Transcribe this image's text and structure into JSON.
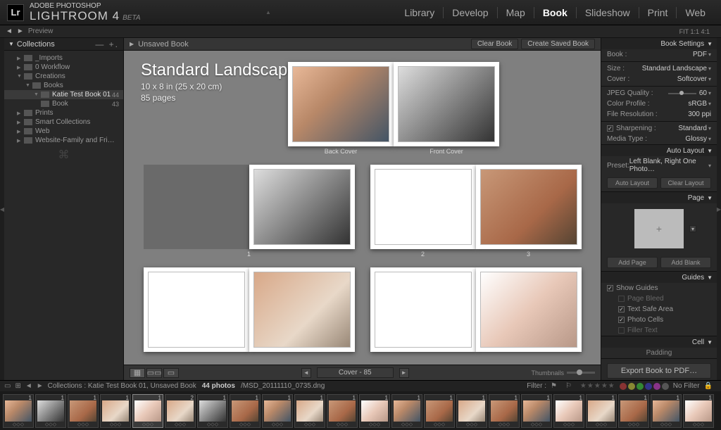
{
  "app": {
    "brand_top": "ADOBE PHOTOSHOP",
    "brand": "LIGHTROOM 4",
    "beta": "BETA"
  },
  "modules": {
    "items": [
      "Library",
      "Develop",
      "Map",
      "Book",
      "Slideshow",
      "Print",
      "Web"
    ],
    "active": "Book"
  },
  "secbar": {
    "preview": "Preview",
    "fit": "FIT   1:1   4:1"
  },
  "collections": {
    "title": "Collections",
    "items": [
      {
        "label": "_Imports",
        "indent": 1,
        "tri": "▶"
      },
      {
        "label": "0 Workflow",
        "indent": 1,
        "tri": "▶"
      },
      {
        "label": "Creations",
        "indent": 1,
        "tri": "▼"
      },
      {
        "label": "Books",
        "indent": 2,
        "tri": "▼"
      },
      {
        "label": "Katie Test Book 01",
        "indent": 3,
        "tri": "▼",
        "count": "44",
        "sel": true
      },
      {
        "label": "Book",
        "indent": 3,
        "tri": "",
        "count": "43",
        "book": true
      },
      {
        "label": "Prints",
        "indent": 1,
        "tri": "▶"
      },
      {
        "label": "Smart Collections",
        "indent": 1,
        "tri": "▶"
      },
      {
        "label": "Web",
        "indent": 1,
        "tri": "▶"
      },
      {
        "label": "Website-Family and Fri…",
        "indent": 1,
        "tri": "▶"
      }
    ]
  },
  "midtop": {
    "title": "Unsaved Book",
    "clear": "Clear Book",
    "save": "Create Saved Book"
  },
  "book": {
    "title": "Standard Landscape",
    "dims": "10 x 8 in (25 x 20 cm)",
    "pages": "85 pages",
    "back_cover": "Back Cover",
    "front_cover": "Front Cover"
  },
  "pager": {
    "label": "Cover - 85",
    "thumbs": "Thumbnails"
  },
  "right": {
    "book_settings": "Book Settings",
    "book": "Book :",
    "book_v": "PDF",
    "size": "Size :",
    "size_v": "Standard Landscape",
    "cover": "Cover :",
    "cover_v": "Softcover",
    "jpeg": "JPEG Quality :",
    "jpeg_v": "60",
    "profile": "Color Profile :",
    "profile_v": "sRGB",
    "res": "File Resolution :",
    "res_v": "300 ppi",
    "sharp": "Sharpening :",
    "sharp_v": "Standard",
    "media": "Media Type :",
    "media_v": "Glossy",
    "auto_layout": "Auto Layout",
    "preset": "Preset:",
    "preset_v": "Left Blank, Right One Photo…",
    "auto_btn": "Auto Layout",
    "clear_btn": "Clear Layout",
    "page": "Page",
    "add_page": "Add Page",
    "add_blank": "Add Blank",
    "guides": "Guides",
    "show_guides": "Show Guides",
    "page_bleed": "Page Bleed",
    "text_safe": "Text Safe Area",
    "photo_cells": "Photo Cells",
    "filler": "Filler Text",
    "cell": "Cell",
    "padding": "Padding",
    "export": "Export Book to PDF…"
  },
  "filmstrip": {
    "path": "Collections : Katie Test Book 01, Unsaved Book",
    "count": "44 photos",
    "file": "/MSD_20111110_0735.dng",
    "filter": "Filter :",
    "nofilter": "No Filter"
  },
  "thumbs": [
    {
      "n": "1",
      "c": "color1"
    },
    {
      "n": "1",
      "c": "bw"
    },
    {
      "n": "1",
      "c": "color2"
    },
    {
      "n": "1",
      "c": "color3"
    },
    {
      "n": "1",
      "c": "color4",
      "sel": true
    },
    {
      "n": "2",
      "c": "color3"
    },
    {
      "n": "1",
      "c": "bw"
    },
    {
      "n": "1",
      "c": "color2"
    },
    {
      "n": "1",
      "c": "color1"
    },
    {
      "n": "1",
      "c": "color3"
    },
    {
      "n": "1",
      "c": "color2"
    },
    {
      "n": "1",
      "c": "color4"
    },
    {
      "n": "1",
      "c": "color1"
    },
    {
      "n": "1",
      "c": "color2"
    },
    {
      "n": "1",
      "c": "color3"
    },
    {
      "n": "1",
      "c": "color2"
    },
    {
      "n": "1",
      "c": "color1"
    },
    {
      "n": "1",
      "c": "color4"
    },
    {
      "n": "1",
      "c": "color3"
    },
    {
      "n": "1",
      "c": "color2"
    },
    {
      "n": "1",
      "c": "color1"
    },
    {
      "n": "1",
      "c": "color4"
    }
  ]
}
